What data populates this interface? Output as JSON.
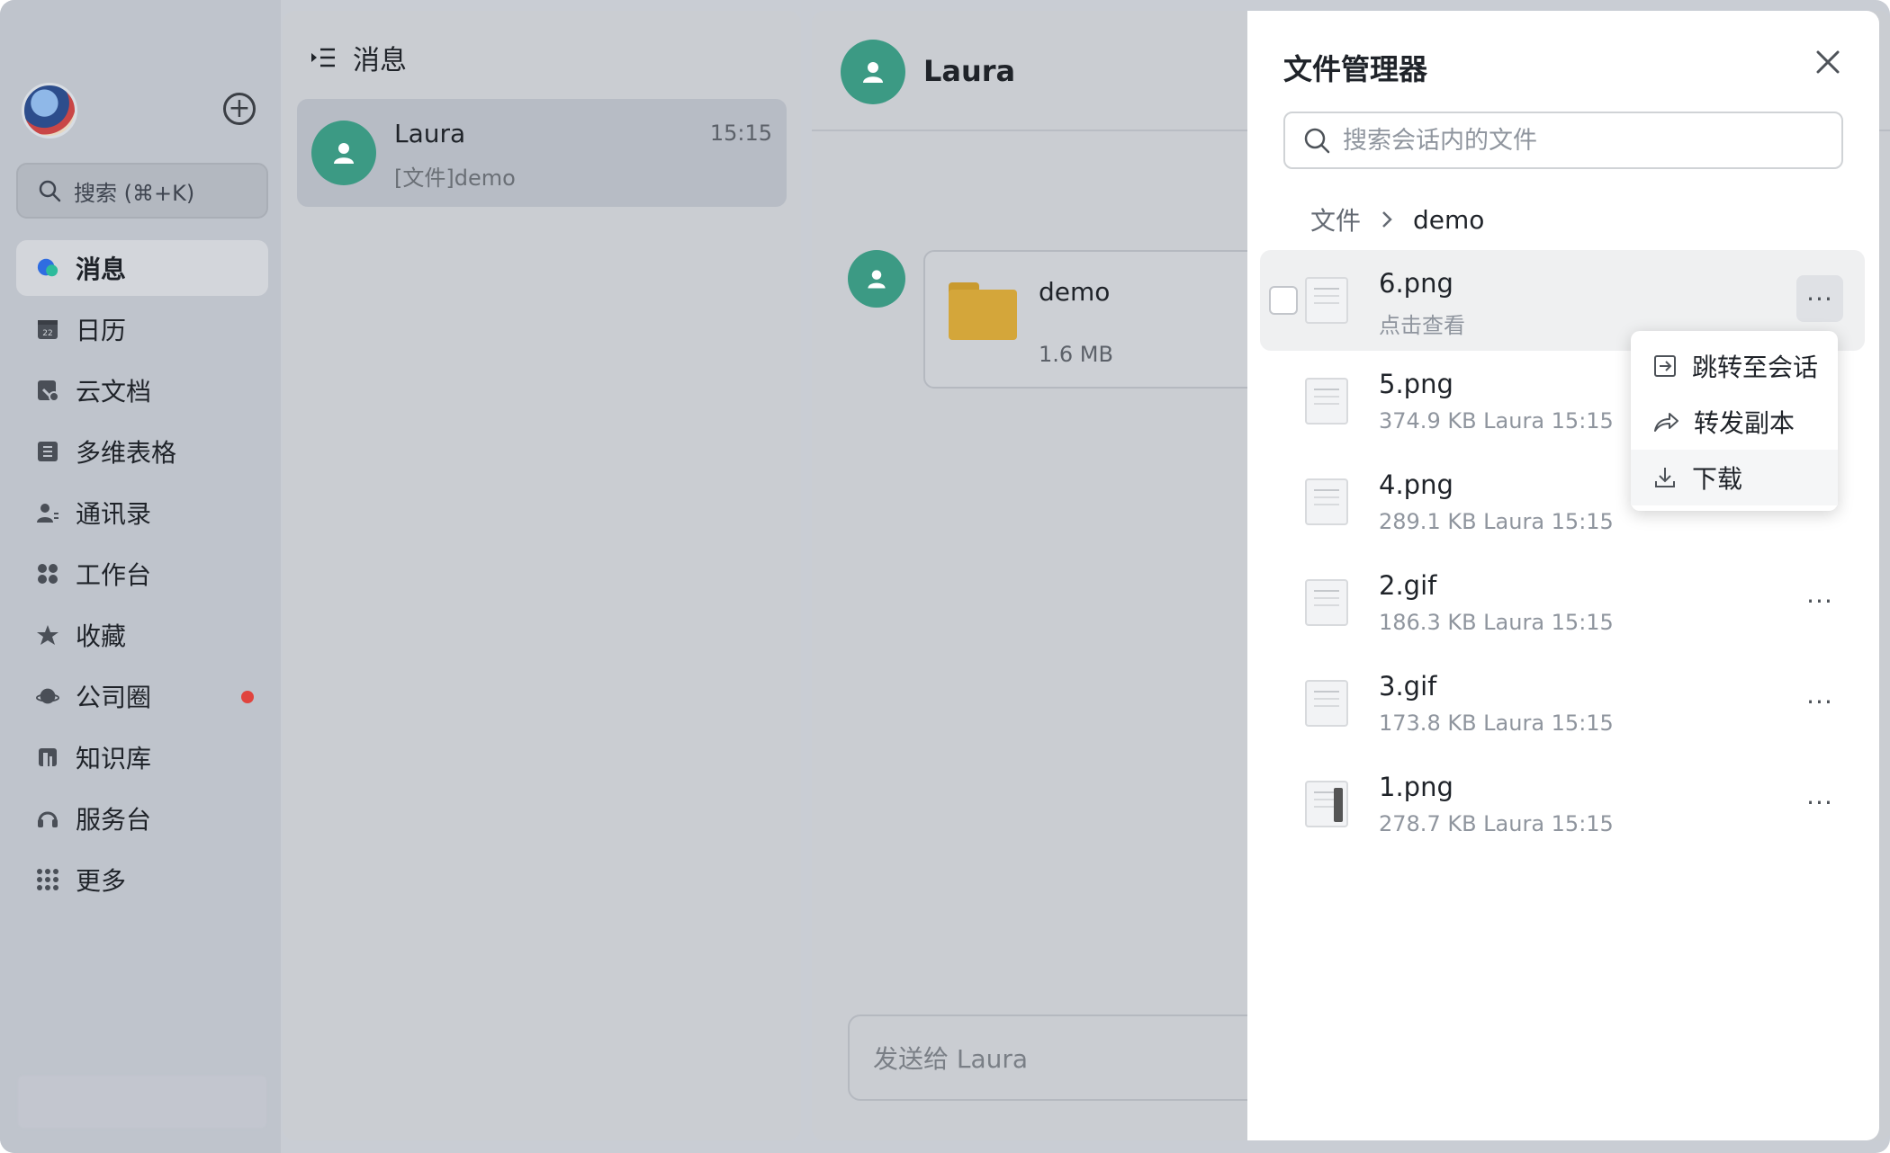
{
  "sidebar": {
    "search_placeholder": "搜索 (⌘+K)",
    "items": [
      {
        "label": "消息",
        "icon": "message-icon"
      },
      {
        "label": "日历",
        "icon": "calendar-icon"
      },
      {
        "label": "云文档",
        "icon": "cloud-doc-icon"
      },
      {
        "label": "多维表格",
        "icon": "table-icon"
      },
      {
        "label": "通讯录",
        "icon": "contacts-icon"
      },
      {
        "label": "工作台",
        "icon": "workspace-icon"
      },
      {
        "label": "收藏",
        "icon": "star-icon"
      },
      {
        "label": "公司圈",
        "icon": "planet-icon"
      },
      {
        "label": "知识库",
        "icon": "book-icon"
      },
      {
        "label": "服务台",
        "icon": "headset-icon"
      },
      {
        "label": "更多",
        "icon": "grid-icon"
      }
    ]
  },
  "conversations": {
    "header": "消息",
    "items": [
      {
        "name": "Laura",
        "time": "15:15",
        "preview": "[文件]demo"
      }
    ]
  },
  "chat": {
    "contact_name": "Laura",
    "message_file": {
      "name": "demo",
      "size": "1.6 MB"
    },
    "input_placeholder": "发送给 Laura"
  },
  "file_manager": {
    "title": "文件管理器",
    "search_placeholder": "搜索会话内的文件",
    "breadcrumb": [
      "文件",
      "demo"
    ],
    "files": [
      {
        "name": "6.png",
        "meta": "点击查看"
      },
      {
        "name": "5.png",
        "meta": "374.9 KB Laura 15:15"
      },
      {
        "name": "4.png",
        "meta": "289.1 KB Laura 15:15"
      },
      {
        "name": "2.gif",
        "meta": "186.3 KB Laura 15:15"
      },
      {
        "name": "3.gif",
        "meta": "173.8 KB Laura 15:15"
      },
      {
        "name": "1.png",
        "meta": "278.7 KB Laura 15:15"
      }
    ],
    "context_menu": [
      "跳转至会话",
      "转发副本",
      "下载"
    ]
  },
  "colors": {
    "accent_avatar": "#3c9a84",
    "folder": "#d4a63a",
    "notification_dot": "#e0443e"
  }
}
